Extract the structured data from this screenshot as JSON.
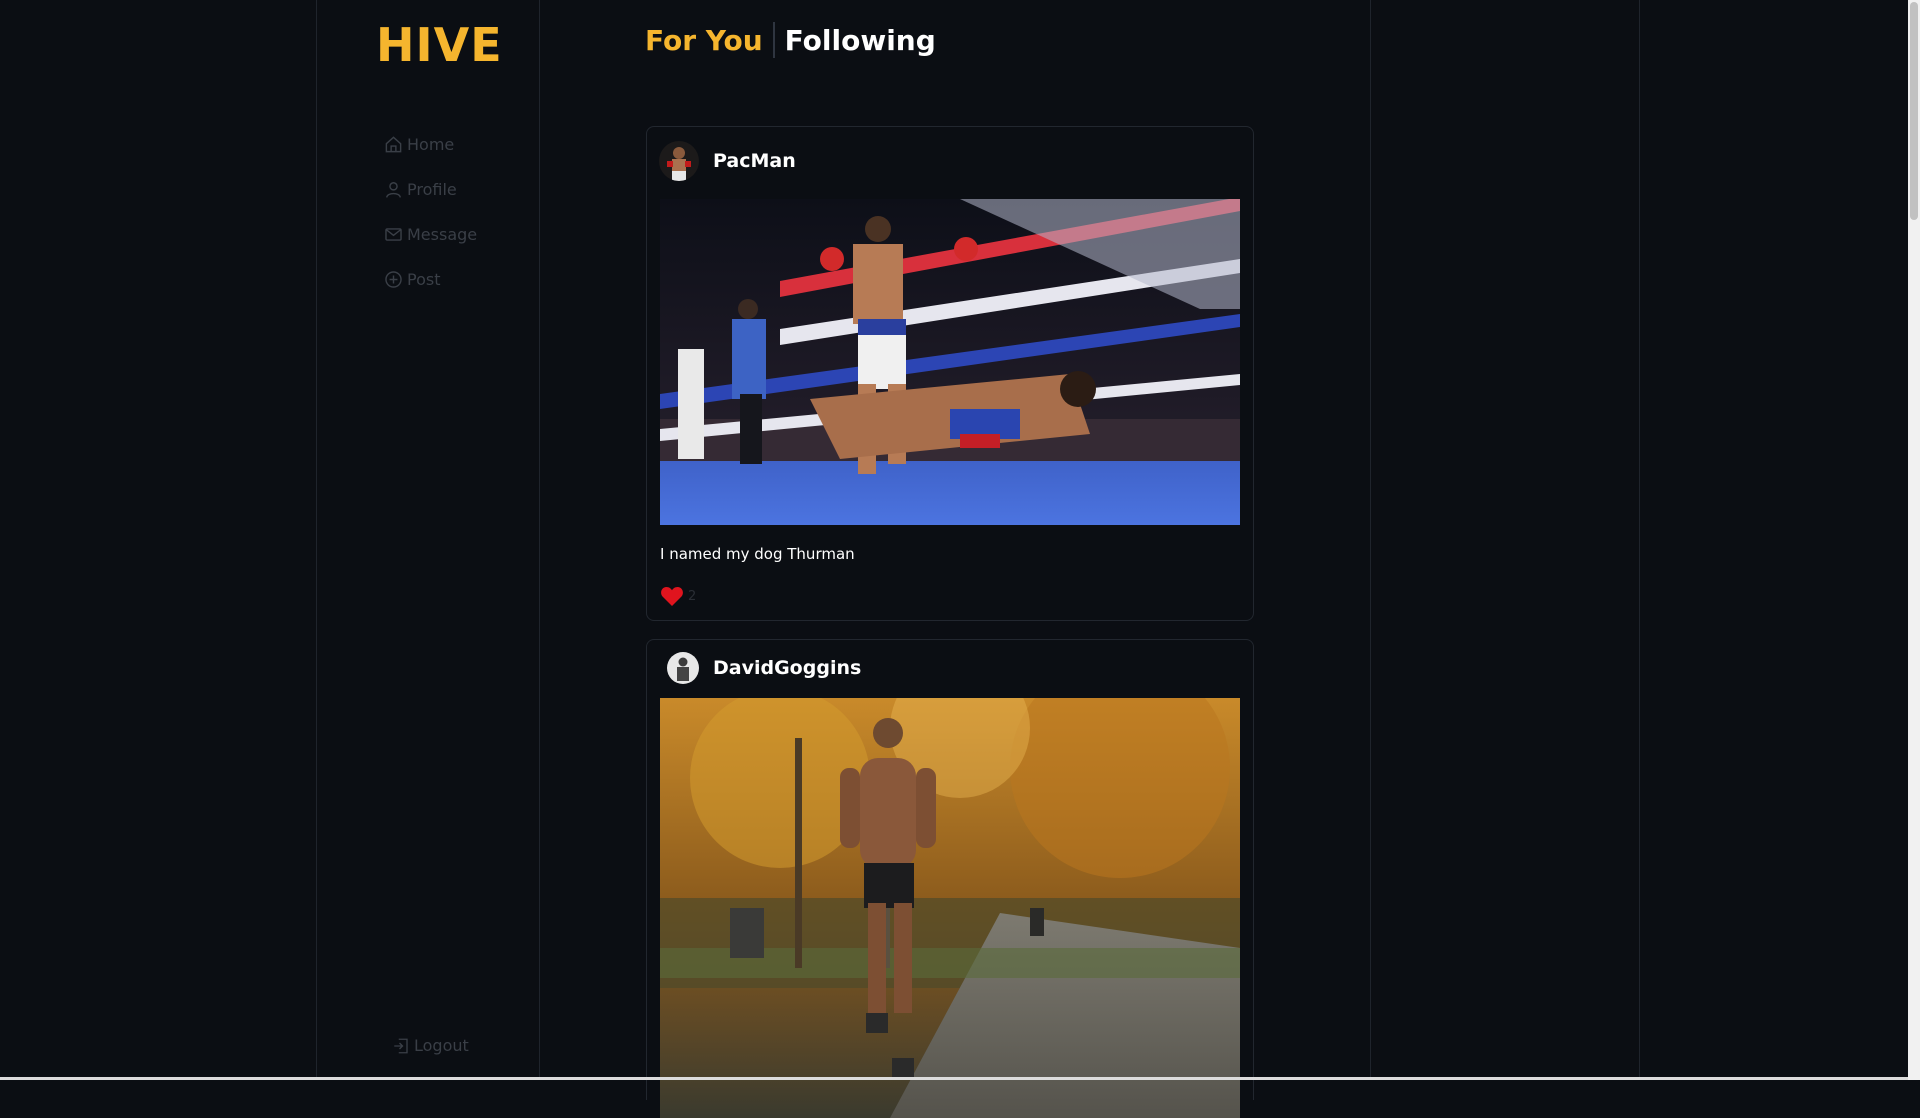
{
  "app": {
    "logo": "HIVE"
  },
  "sidebar": {
    "items": [
      {
        "label": "Home",
        "icon": "home-icon"
      },
      {
        "label": "Profile",
        "icon": "user-icon"
      },
      {
        "label": "Message",
        "icon": "mail-icon"
      },
      {
        "label": "Post",
        "icon": "plus-circle-icon"
      }
    ],
    "logout": {
      "label": "Logout",
      "icon": "logout-icon"
    }
  },
  "tabs": [
    {
      "label": "For You",
      "active": true
    },
    {
      "label": "Following",
      "active": false
    }
  ],
  "posts": [
    {
      "username": "PacMan",
      "caption": "I named my dog Thurman",
      "likes": "2",
      "liked": true
    },
    {
      "username": "DavidGoggins"
    }
  ],
  "colors": {
    "accent": "#f5b52e",
    "background": "#0b0e13",
    "like": "#e0141e"
  }
}
